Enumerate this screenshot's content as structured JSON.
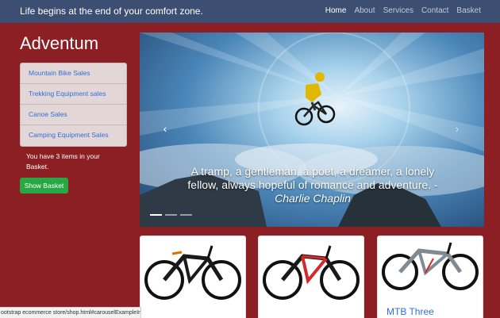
{
  "navbar": {
    "brand": "Life begins at the end of your comfort zone.",
    "links": [
      "Home",
      "About",
      "Services",
      "Contact",
      "Basket"
    ]
  },
  "sidebar": {
    "title": "Adventum",
    "menu": [
      "Mountain Bike Sales",
      "Trekking Equipment sales",
      "Canoe Sales",
      "Camping Equipment Sales"
    ],
    "basket_text": "You have 3 items in your Basket.",
    "show_basket_label": "Show Basket"
  },
  "carousel": {
    "caption_quote": "A tramp, a gentleman, a poet, a dreamer, a lonely fellow, always hopeful of romance and adventure. -",
    "caption_author": "Charlie Chaplin",
    "prev_icon": "‹",
    "next_icon": "›",
    "slide_count": 3,
    "active_slide": 1
  },
  "products": {
    "card3_title": "MTB Three"
  },
  "status_bar": "ootstrap ecommerce store/shop.html#carouselExampleIndicators",
  "colors": {
    "page_bg": "#8c1f23",
    "navbar_bg": "#3c4f73",
    "button_green": "#28a745",
    "link_blue": "#2f6fe0"
  }
}
